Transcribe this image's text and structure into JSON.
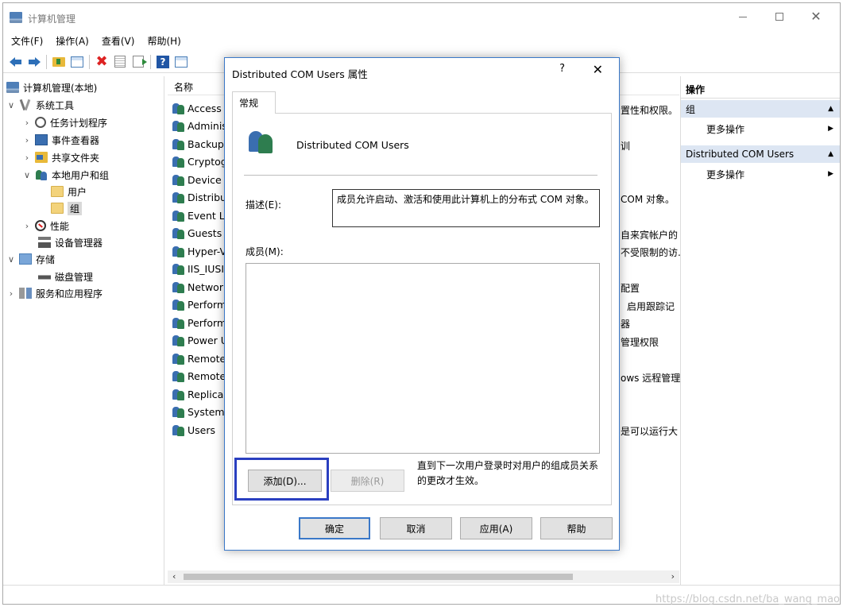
{
  "window": {
    "title": "计算机管理",
    "menu": [
      "文件(F)",
      "操作(A)",
      "查看(V)",
      "帮助(H)"
    ]
  },
  "tree": {
    "items": [
      {
        "label": "计算机管理(本地)",
        "icon": "computer-icon"
      },
      {
        "label": "系统工具",
        "icon": "tools-icon",
        "expander": "∨"
      },
      {
        "label": "任务计划程序",
        "icon": "clock-icon",
        "expander": "›"
      },
      {
        "label": "事件查看器",
        "icon": "event-viewer-icon",
        "expander": "›"
      },
      {
        "label": "共享文件夹",
        "icon": "shared-folder-icon",
        "expander": "›"
      },
      {
        "label": "本地用户和组",
        "icon": "users-icon",
        "expander": "∨"
      },
      {
        "label": "用户",
        "icon": "folder-icon"
      },
      {
        "label": "组",
        "icon": "folder-icon",
        "selected": true
      },
      {
        "label": "性能",
        "icon": "performance-icon",
        "expander": "›"
      },
      {
        "label": "设备管理器",
        "icon": "device-manager-icon"
      },
      {
        "label": "存储",
        "icon": "storage-icon",
        "expander": "∨"
      },
      {
        "label": "磁盘管理",
        "icon": "disk-icon"
      },
      {
        "label": "服务和应用程序",
        "icon": "services-icon",
        "expander": "›"
      }
    ]
  },
  "list": {
    "column_name": "名称",
    "rows": [
      "Access",
      "Adminis",
      "Backup",
      "Cryptog",
      "Device",
      "Distribu",
      "Event L",
      "Guests",
      "Hyper-V",
      "IIS_IUSI",
      "Networ",
      "Perform",
      "Perform",
      "Power U",
      "Remote",
      "Remote",
      "Replica",
      "System",
      "Users"
    ],
    "desc_fragments": [
      "置性和权限。",
      "训",
      "COM 对象。",
      "自来宾帐户的",
      "不受限制的访.",
      "配置",
      "启用跟踪记",
      "器",
      "管理权限",
      "ows 远程管理",
      "是可以运行大"
    ]
  },
  "actions": {
    "title": "操作",
    "sections": [
      {
        "label": "组",
        "item": "更多操作"
      },
      {
        "label": "Distributed COM Users",
        "item": "更多操作"
      }
    ]
  },
  "dialog": {
    "title": "Distributed COM Users 属性",
    "help": "?",
    "close": "✕",
    "tab": "常规",
    "group_name": "Distributed COM Users",
    "desc_label": "描述(E):",
    "description": "成员允许启动、激活和使用此计算机上的分布式 COM 对象。",
    "members_label": "成员(M):",
    "add_button": "添加(D)...",
    "remove_button": "删除(R)",
    "note": "直到下一次用户登录时对用户的组成员关系的更改才生效。",
    "ok_button": "确定",
    "cancel_button": "取消",
    "apply_button": "应用(A)",
    "help_button": "帮助"
  },
  "watermark": "https://blog.csdn.net/ba_wang_mao",
  "colors": {
    "dialog_border": "#3a78c8",
    "highlight": "#2a3fc0",
    "action_section_bg": "#dde6f3"
  }
}
